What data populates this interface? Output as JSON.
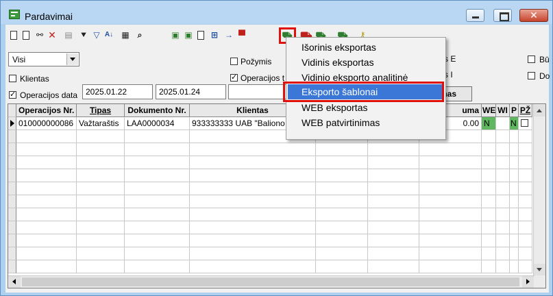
{
  "window": {
    "title": "Pardavimai"
  },
  "toolbar": {
    "icons": [
      "new-doc-icon",
      "copy-doc-icon",
      "link-doc-icon",
      "delete-icon",
      "paste-icon",
      "hierarchy-icon",
      "filter-icon",
      "sort-az-icon",
      "print-icon",
      "find-icon",
      "money-add-icon",
      "money-copy-icon",
      "doc-icon",
      "tree-icon",
      "import-icon",
      "export-red-icon",
      "export-green-icon",
      "cart-red-icon",
      "cart-green-icon",
      "cart-yellow-icon",
      "key-icon"
    ]
  },
  "filters": {
    "status_select": "Visi",
    "pozymis_label": "Požymis",
    "klientas_label": "Klientas",
    "operacijos_t_label": "Operacijos t",
    "operacijos_data_label": "Operacijos data",
    "date_from": "2025.01.22",
    "date_to": "2025.01.24",
    "right_label_1": "s E",
    "right_label_2": "s I",
    "far_right_1": "Bū",
    "far_right_2": "Do",
    "suma_button": "mas"
  },
  "grid": {
    "headers": [
      "Operacijos Nr.",
      "Tipas",
      "Dokumento Nr.",
      "Klientas",
      "uma",
      "WE",
      "WI",
      "P",
      "PŽ"
    ],
    "rows": [
      {
        "operacijos_nr": "010000000086",
        "tipas": "Važtaraštis",
        "dokumento_nr": "LAA0000034",
        "klientas": "933333333  UAB \"Baliono",
        "suma": "0.00",
        "we": "N",
        "p": "N"
      }
    ]
  },
  "menu": {
    "items": [
      {
        "label": "Išorinis eksportas"
      },
      {
        "label": "Vidinis eksportas"
      },
      {
        "label": "Vidinio eksporto analitinė"
      },
      {
        "label": "Eksporto šablonai"
      },
      {
        "label": "WEB eksportas"
      },
      {
        "label": "WEB patvirtinimas"
      }
    ],
    "selected_index": 3
  }
}
